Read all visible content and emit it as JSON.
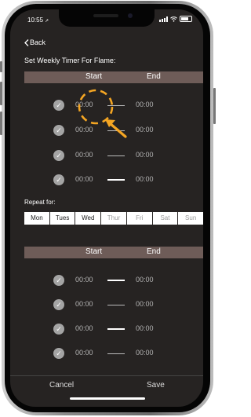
{
  "status_bar": {
    "time": "10:55"
  },
  "nav": {
    "back_label": "Back"
  },
  "timer": {
    "title": "Set Weekly Timer For Flame:",
    "header_start": "Start",
    "header_end": "End",
    "rows_top": [
      {
        "start": "00:00",
        "end": "00:00"
      },
      {
        "start": "00:00",
        "end": "00:00"
      },
      {
        "start": "00:00",
        "end": "00:00"
      },
      {
        "start": "00:00",
        "end": "00:00"
      }
    ],
    "repeat_label": "Repeat for:",
    "days": [
      "Mon",
      "Tues",
      "Wed",
      "Thur",
      "Fri",
      "Sat",
      "Sun"
    ],
    "header2_start": "Start",
    "header2_end": "End",
    "rows_bottom": [
      {
        "start": "00:00",
        "end": "00:00"
      },
      {
        "start": "00:00",
        "end": "00:00"
      },
      {
        "start": "00:00",
        "end": "00:00"
      },
      {
        "start": "00:00",
        "end": "00:00"
      }
    ]
  },
  "footer": {
    "cancel_label": "Cancel",
    "save_label": "Save"
  },
  "colors": {
    "screen_bg": "#262322",
    "header_bar": "#6e5c58",
    "annotation": "#f5a623"
  }
}
